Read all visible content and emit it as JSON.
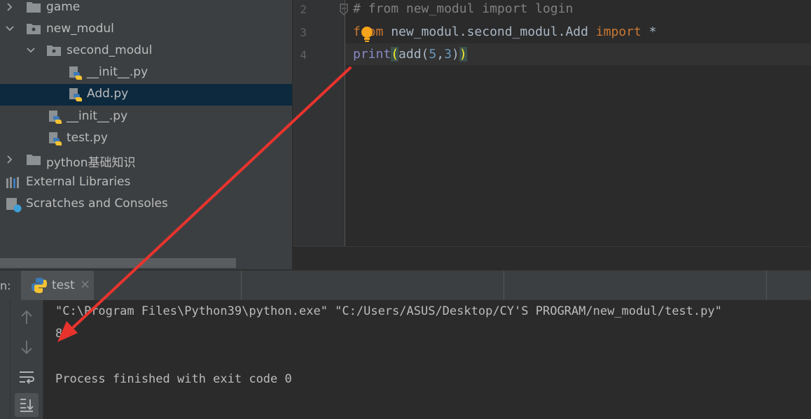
{
  "project_tree": {
    "items": [
      {
        "label": "game"
      },
      {
        "label": "new_modul"
      },
      {
        "label": "second_modul"
      },
      {
        "label": "__init__.py"
      },
      {
        "label": "Add.py"
      },
      {
        "label": "__init__.py"
      },
      {
        "label": "test.py"
      },
      {
        "label": "python基础知识"
      },
      {
        "label": "External Libraries"
      },
      {
        "label": "Scratches and Consoles"
      }
    ]
  },
  "editor": {
    "line_numbers": [
      "2",
      "3",
      "4"
    ],
    "lines": {
      "l2_hash": "# ",
      "l2_from": "from",
      "l2_rest": " new_modul import login",
      "l3_from": "from",
      "l3_mod": " new_modul.second_modul.Add ",
      "l3_import": "import",
      "l3_star": " *",
      "l4_print": "print",
      "l4_open": "(",
      "l4_add": "add(",
      "l4_n1": "5",
      "l4_comma": ",",
      "l4_n2": "3",
      "l4_close1": ")",
      "l4_close2": ")"
    }
  },
  "run_panel": {
    "label": "n:",
    "tab_name": "test",
    "tab_close": "×",
    "console_lines": [
      "\"C:\\Program Files\\Python39\\python.exe\" \"C:/Users/ASUS/Desktop/CY'S PROGRAM/new_modul/test.py\"",
      "8",
      "",
      "Process finished with exit code 0"
    ]
  },
  "colors": {
    "annotation_arrow": "#e8332d",
    "selection": "#0d293e",
    "keyword": "#cc7832"
  }
}
